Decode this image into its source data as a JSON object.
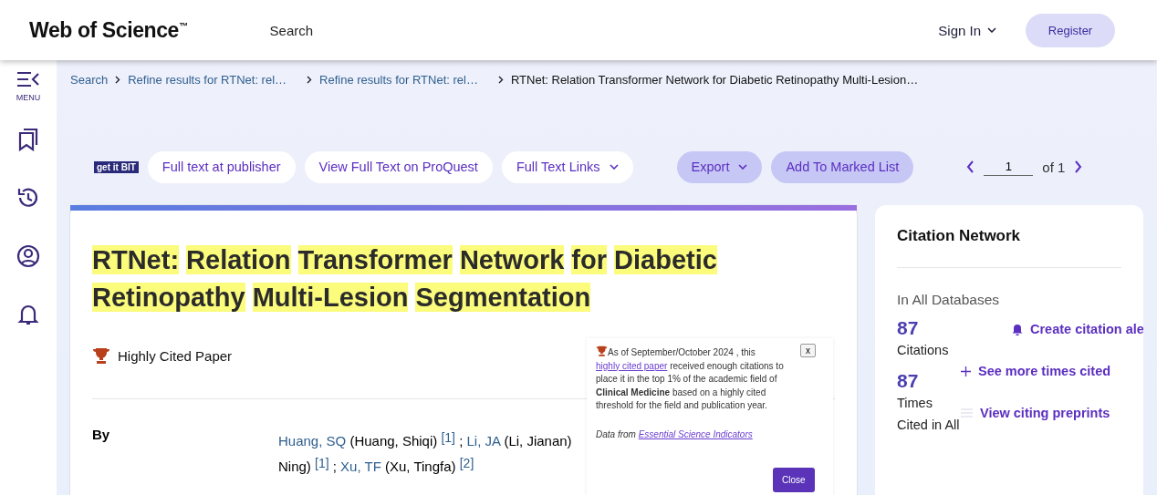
{
  "header": {
    "logo": "Web of Science",
    "logo_mark": "™",
    "nav": "Search",
    "sign_in": "Sign In",
    "register": "Register"
  },
  "sidebar": {
    "menu_label": "MENU",
    "items": [
      {
        "kind": "bookmarks"
      },
      {
        "kind": "history"
      },
      {
        "kind": "profile"
      },
      {
        "kind": "alerts"
      }
    ]
  },
  "breadcrumbs": [
    {
      "label": "Search",
      "current": false
    },
    {
      "label": "Refine results for RTNet: rel…",
      "current": false
    },
    {
      "label": "Refine results for RTNet: rel…",
      "current": false
    },
    {
      "label": "RTNet: Relation Transformer Network for Diabetic Retinopathy Multi-Lesion…",
      "current": true
    }
  ],
  "toolbar": {
    "getit_logo": "get it BIT",
    "links": [
      {
        "label": "Full text at publisher",
        "dropdown": false
      },
      {
        "label": "View Full Text on ProQuest",
        "dropdown": false
      },
      {
        "label": "Full Text Links",
        "dropdown": true
      }
    ],
    "actions": [
      {
        "label": "Export",
        "dropdown": true
      },
      {
        "label": "Add To Marked List",
        "dropdown": false
      }
    ],
    "pager": {
      "value": "1",
      "of": "of 1"
    }
  },
  "record": {
    "title": "RTNet: Relation Transformer Network for Diabetic Retinopathy Multi-Lesion Segmentation",
    "highlighted": true,
    "badge": "Highly Cited Paper",
    "by_label": "By",
    "author_lines": [
      [
        {
          "kind": "link",
          "text": "Huang, SQ"
        },
        {
          "kind": "text",
          "text": " (Huang, Shiqi) "
        },
        {
          "kind": "ref",
          "text": "[1]"
        },
        {
          "kind": "text",
          "text": " ; "
        },
        {
          "kind": "link",
          "text": "Li, JA"
        },
        {
          "kind": "text",
          "text": " (Li, Jianan)"
        }
      ],
      [
        {
          "kind": "text",
          "text": "Ning) "
        },
        {
          "kind": "ref",
          "text": "[1]"
        },
        {
          "kind": "text",
          "text": " ; "
        },
        {
          "kind": "link",
          "text": "Xu, TF"
        },
        {
          "kind": "text",
          "text": " (Xu, Tingfa) "
        },
        {
          "kind": "ref",
          "text": "[2]"
        }
      ]
    ]
  },
  "popup": {
    "text_before": "As of September/October 2024 , this ",
    "link": "highly cited paper",
    "text_after": " received enough citations to place it in the top 1% of the academic field of **Clinical Medicine** based on a highly cited threshold for the field and publication year.",
    "source_label": "Data from",
    "source_link": "Essential Science Indicators",
    "close_x": "x",
    "close_button": "Close"
  },
  "citation_network": {
    "title": "Citation Network",
    "section": "In All Databases",
    "citations_count": "87",
    "citations_label": "Citations",
    "times_cited_count": "87",
    "times_cited_label": "Times Cited in All",
    "links": [
      {
        "kind": "alert",
        "label": "Create citation ale"
      },
      {
        "kind": "more",
        "label": "See more times cited"
      },
      {
        "kind": "preprints",
        "label": "View citing preprints"
      }
    ]
  }
}
